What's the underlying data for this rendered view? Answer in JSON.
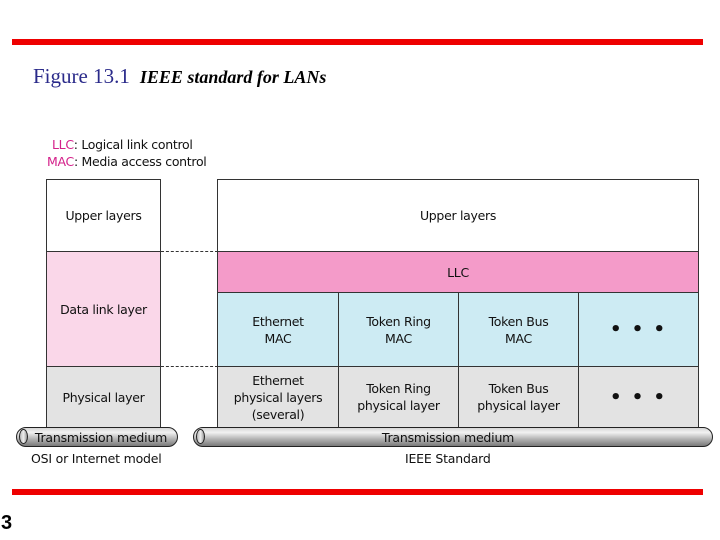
{
  "slide": {
    "figure_number": "Figure 13.1",
    "figure_caption": "IEEE standard for LANs",
    "page_number": "3"
  },
  "colors": {
    "rule": "#ee0000",
    "figure_number": "#2a2a8a",
    "abbreviation": "#d4208a",
    "upper_layers": "#ffffff",
    "data_link_osi": "#fad7e9",
    "llc": "#f49bc9",
    "mac": "#cdebf3",
    "physical": "#e3e3e3"
  },
  "legend": [
    {
      "abbr": "LLC",
      "text": ": Logical link control"
    },
    {
      "abbr": "MAC",
      "text": ": Media access control"
    }
  ],
  "osi_model": {
    "layers": {
      "upper": "Upper layers",
      "data_link": "Data link layer",
      "physical": "Physical layer"
    },
    "medium": "Transmission medium",
    "caption": "OSI or Internet model"
  },
  "ieee_standard": {
    "upper": "Upper layers",
    "llc": "LLC",
    "mac": [
      {
        "line1": "Ethernet",
        "line2": "MAC"
      },
      {
        "line1": "Token Ring",
        "line2": "MAC"
      },
      {
        "line1": "Token Bus",
        "line2": "MAC"
      },
      {
        "line1": "• • •",
        "line2": ""
      }
    ],
    "physical": [
      {
        "line1": "Ethernet",
        "line2": "physical layers",
        "line3": "(several)"
      },
      {
        "line1": "Token Ring",
        "line2": "physical layer",
        "line3": ""
      },
      {
        "line1": "Token Bus",
        "line2": "physical layer",
        "line3": ""
      },
      {
        "line1": "• • •",
        "line2": "",
        "line3": ""
      }
    ],
    "medium": "Transmission medium",
    "caption": "IEEE Standard"
  }
}
